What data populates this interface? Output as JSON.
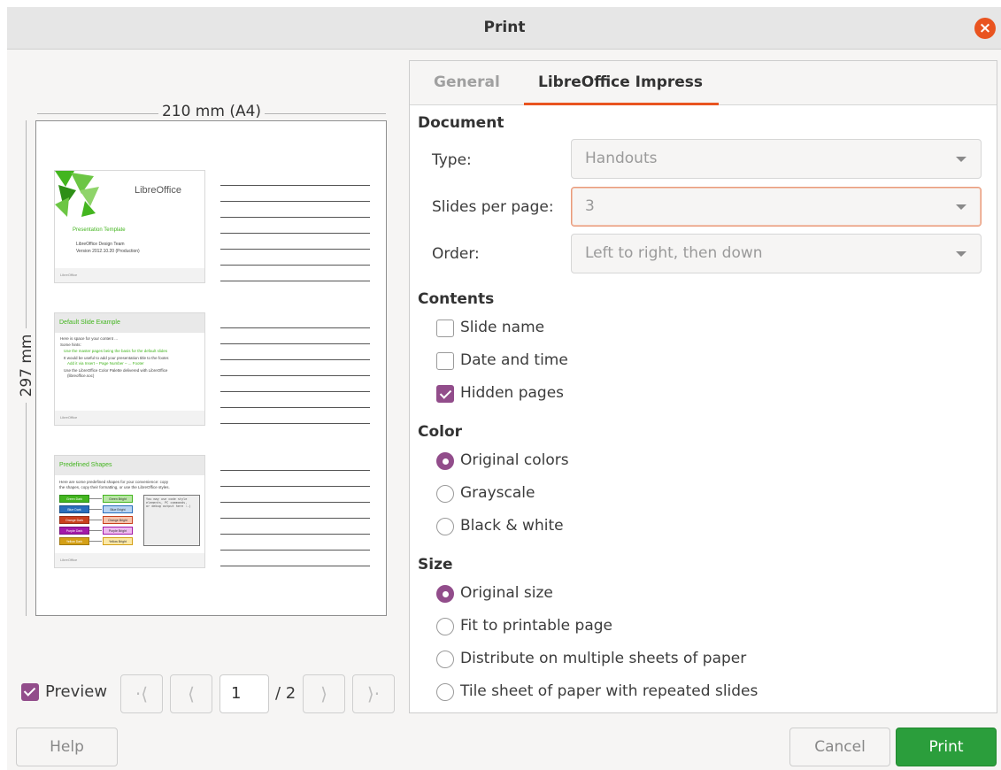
{
  "title": "Print",
  "preview": {
    "paper_width_label": "210 mm (A4)",
    "paper_height_label": "297 mm",
    "slides": [
      {
        "logo_text": "LibreOffice",
        "title": "Presentation Template",
        "lines": [
          "LibreOffice Design Team",
          "Version 2012.10.20 (Production)"
        ],
        "footer": "LibreOffice"
      },
      {
        "header": "Default Slide Example",
        "lines": [
          "Here is space for your content ...",
          "Some hints:",
          "Use the master pages being the basis for the default slides",
          "It would be useful to add your presentation title to the footer.",
          "Add it via Insert – Page Number – ... Footer",
          "Use the LibreOffice Color Palette delivered with LibreOffice",
          "(libreoffice.soc)"
        ],
        "footer": "LibreOffice"
      },
      {
        "header": "Predefined Shapes",
        "lines": [
          "Here are some predefined shapes for your convenience: copy",
          "the shapes, copy their formatting, or use the LibreOffice styles."
        ],
        "left_boxes": [
          "Green Dark",
          "Blue Dark",
          "Orange Dark",
          "Purple Dark",
          "Yellow Dark"
        ],
        "right_boxes": [
          "Green Bright",
          "Blue Bright",
          "Orange Bright",
          "Purple Bright",
          "Yellow Bright"
        ],
        "code_text": [
          "You may use code style",
          "elements, PC commands,",
          "or debug output here :-)"
        ],
        "footer": "LibreOffice"
      }
    ],
    "preview_label": "Preview",
    "preview_checked": true,
    "current_page": "1",
    "total_pages": "/ 2",
    "nav": {
      "first": "·⟨",
      "prev": "⟨",
      "next": "⟩",
      "last": "⟩·"
    }
  },
  "tabs": [
    "General",
    "LibreOffice Impress"
  ],
  "active_tab": "LibreOffice Impress",
  "document": {
    "heading": "Document",
    "type_label": "Type:",
    "type_value": "Handouts",
    "slides_label": "Slides per page:",
    "slides_value": "3",
    "order_label": "Order:",
    "order_value": "Left to right, then down"
  },
  "contents": {
    "heading": "Contents",
    "options": [
      {
        "label": "Slide name",
        "checked": false
      },
      {
        "label": "Date and time",
        "checked": false
      },
      {
        "label": "Hidden pages",
        "checked": true
      }
    ]
  },
  "color": {
    "heading": "Color",
    "options": [
      "Original colors",
      "Grayscale",
      "Black & white"
    ],
    "selected": "Original colors"
  },
  "size": {
    "heading": "Size",
    "options": [
      "Original size",
      "Fit to printable page",
      "Distribute on multiple sheets of paper",
      "Tile sheet of paper with repeated slides"
    ],
    "selected": "Original size"
  },
  "buttons": {
    "help": "Help",
    "cancel": "Cancel",
    "print": "Print"
  },
  "colors": {
    "accent": "#e95420",
    "check": "#924d8b",
    "print_button": "#2b9e3c",
    "slide_green": "#43b51f"
  }
}
